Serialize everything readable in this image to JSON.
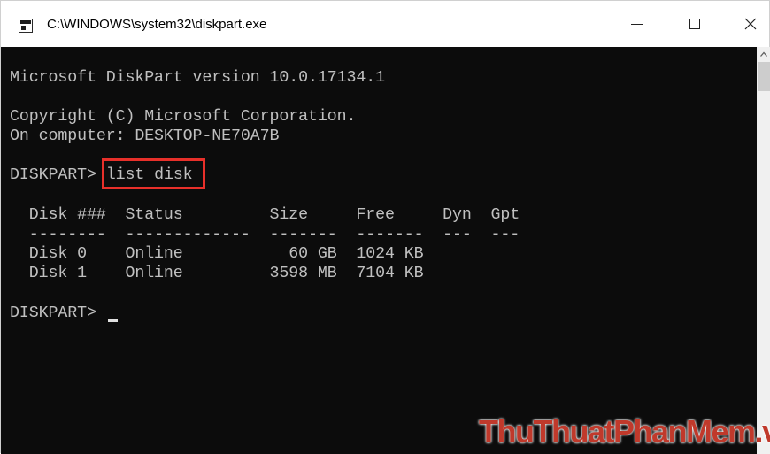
{
  "window": {
    "title": "C:\\WINDOWS\\system32\\diskpart.exe",
    "icon": "console-app-icon"
  },
  "controls": {
    "minimize": "minimize-icon",
    "maximize": "maximize-icon",
    "close": "close-icon"
  },
  "console": {
    "version_line": "Microsoft DiskPart version 10.0.17134.1",
    "copyright_line": "Copyright (C) Microsoft Corporation.",
    "computer_line": "On computer: DESKTOP-NE70A7B",
    "prompt": "DISKPART> ",
    "command": "list disk",
    "table": {
      "header": "  Disk ###  Status         Size     Free     Dyn  Gpt",
      "separator": "  --------  -------------  -------  -------  ---  ---",
      "rows": [
        "  Disk 0    Online           60 GB  1024 KB",
        "  Disk 1    Online         3598 MB  7104 KB"
      ]
    },
    "final_prompt": "DISKPART> "
  },
  "highlight": {
    "color": "#e8302a"
  },
  "watermark": {
    "text": "ThuThuatPhanMem.vn",
    "color": "#c0392b"
  }
}
